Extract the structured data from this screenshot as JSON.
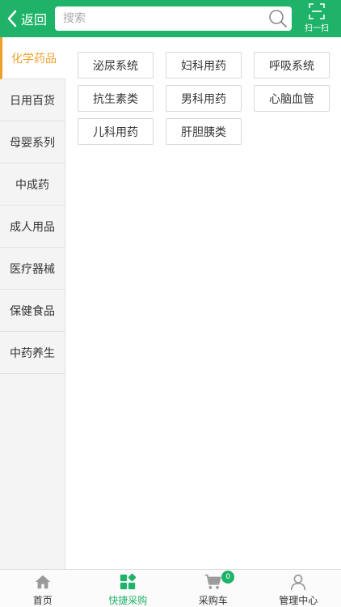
{
  "header": {
    "back_label": "返回",
    "search_placeholder": "搜索",
    "scan_label": "扫一扫"
  },
  "sidebar": {
    "items": [
      {
        "label": "化学药品",
        "active": true
      },
      {
        "label": "日用百货"
      },
      {
        "label": "母婴系列"
      },
      {
        "label": "中成药"
      },
      {
        "label": "成人用品"
      },
      {
        "label": "医疗器械"
      },
      {
        "label": "保健食品"
      },
      {
        "label": "中药养生"
      }
    ]
  },
  "subcategories": [
    "泌尿系统",
    "妇科用药",
    "呼吸系统",
    "抗生素类",
    "男科用药",
    "心脑血管",
    "儿科用药",
    "肝胆胰类"
  ],
  "tabbar": {
    "items": [
      {
        "label": "首页",
        "icon": "home-icon"
      },
      {
        "label": "快捷采购",
        "icon": "grid-icon",
        "active": true
      },
      {
        "label": "采购车",
        "icon": "cart-icon",
        "badge": "0"
      },
      {
        "label": "管理中心",
        "icon": "user-icon"
      }
    ]
  },
  "colors": {
    "brand": "#1fb36a",
    "active_category": "#f0a02a"
  }
}
